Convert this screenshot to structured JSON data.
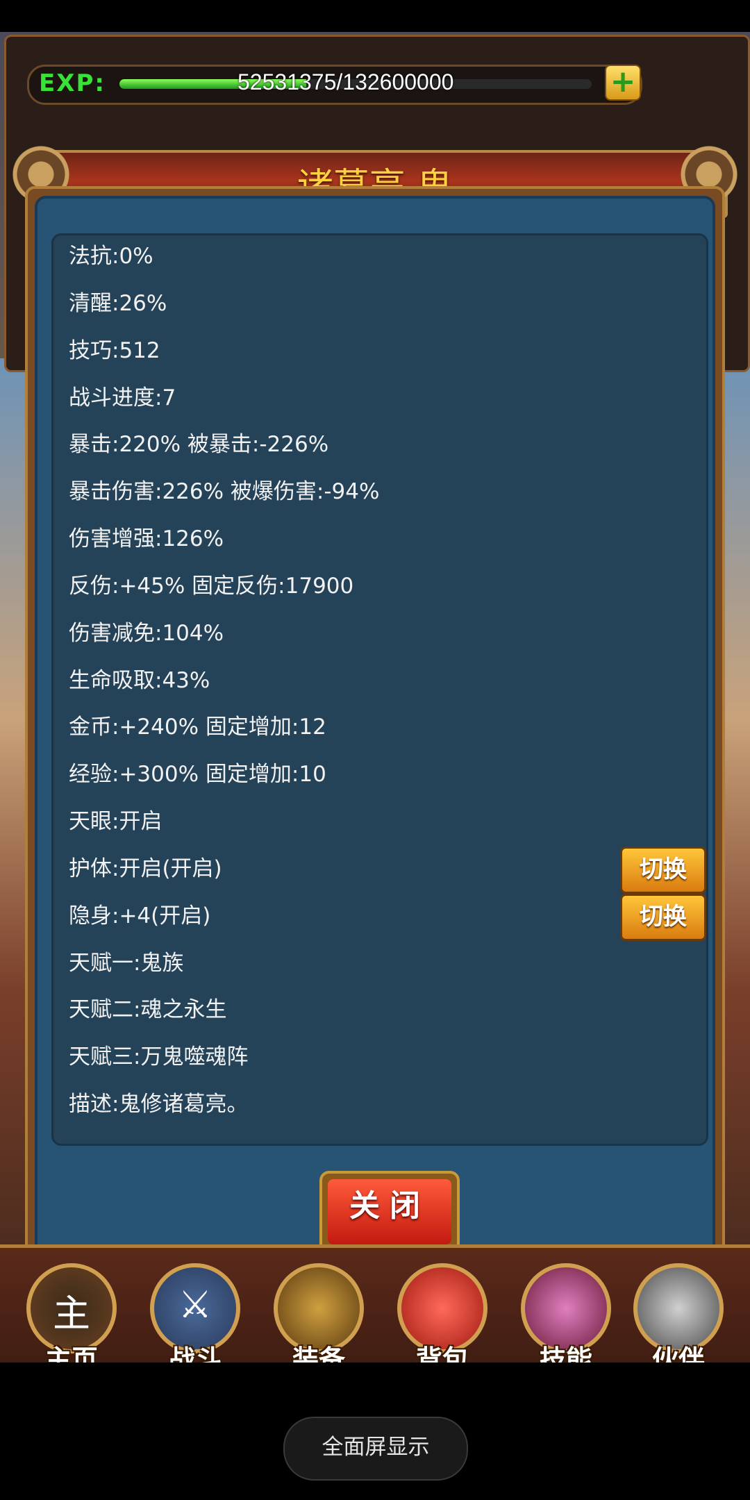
{
  "exp": {
    "label": "EXP:",
    "current": 52531375,
    "max": 132600000,
    "text": "52531375/132600000",
    "progress_fraction": 0.396,
    "plus_icon": "plus-icon"
  },
  "dialog": {
    "title": "诸葛亮.鬼",
    "stats": [
      "法抗:0%",
      "清醒:26%",
      "技巧:512",
      "战斗进度:7",
      "暴击:220% 被暴击:-226%",
      "暴击伤害:226% 被爆伤害:-94%",
      "伤害增强:126%",
      "反伤:+45% 固定反伤:17900",
      "伤害减免:104%",
      "生命吸取:43%",
      "金币:+240% 固定增加:12",
      "经验:+300% 固定增加:10",
      "天眼:开启",
      "护体:开启(开启)",
      "隐身:+4(开启)",
      "天赋一:鬼族",
      "天赋二:魂之永生",
      "天赋三:万鬼噬魂阵",
      "描述:鬼修诸葛亮。"
    ],
    "switch_label_1": "切换",
    "switch_label_2": "切换",
    "close_label": "关闭"
  },
  "nav": {
    "items": [
      {
        "label": "主页",
        "icon": "home-icon",
        "glyph": "主"
      },
      {
        "label": "战斗",
        "icon": "battle-icon",
        "glyph": "⚔"
      },
      {
        "label": "装备",
        "icon": "equipment-icon",
        "glyph": ""
      },
      {
        "label": "背包",
        "icon": "bag-icon",
        "glyph": ""
      },
      {
        "label": "技能",
        "icon": "skill-icon",
        "glyph": ""
      },
      {
        "label": "伙伴",
        "icon": "partner-icon",
        "glyph": ""
      }
    ]
  },
  "fullscreen": {
    "label": "全面屏显示"
  },
  "colors": {
    "exp_green": "#36e336",
    "title_gold": "#ffd040",
    "panel_blue": "#244258",
    "close_red": "#c21a10",
    "switch_orange": "#d97c10"
  }
}
